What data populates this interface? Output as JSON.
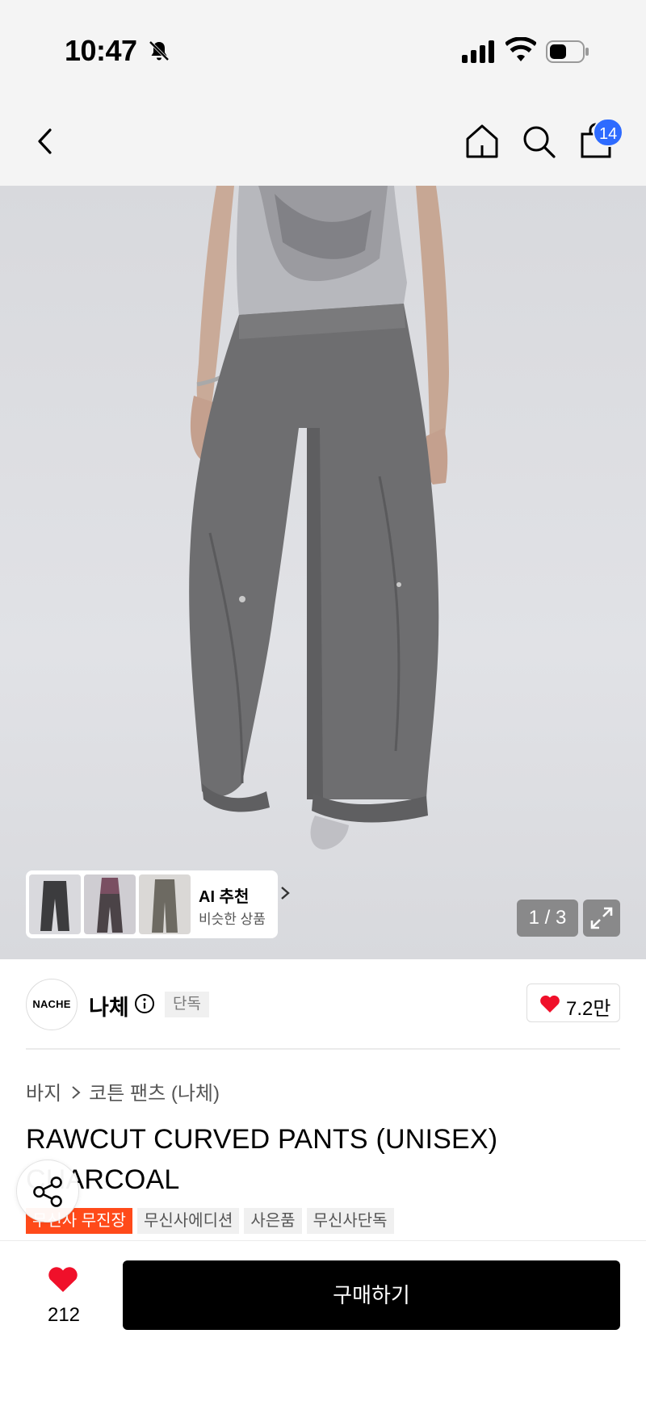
{
  "status": {
    "time": "10:47",
    "icons": [
      "bell-slash-icon",
      "signal-icon",
      "wifi-icon",
      "battery-icon"
    ]
  },
  "nav": {
    "icons": [
      "back-icon",
      "home-icon",
      "search-icon",
      "cart-icon"
    ],
    "cart_count": "14"
  },
  "gallery": {
    "counter": "1 / 3",
    "ai_title": "AI 추천",
    "ai_subtitle": "비슷한 상품"
  },
  "brand": {
    "logo_text": "NACHE",
    "name": "나체",
    "badge": "단독",
    "likes": "7.2만"
  },
  "breadcrumb": {
    "category": "바지",
    "subcategory": "코튼 팬츠 (나체)"
  },
  "product": {
    "title": "RAWCUT CURVED PANTS (UNISEX) CHARCOAL",
    "tags": [
      "무신사 무진장",
      "무신사에디션",
      "사은품",
      "무신사단독"
    ]
  },
  "bottom": {
    "wish_count": "212",
    "buy_label": "구매하기"
  },
  "colors": {
    "accent_blue": "#2e6bff",
    "heart_red": "#f0102a",
    "tag_orange": "#ff4a1a"
  }
}
